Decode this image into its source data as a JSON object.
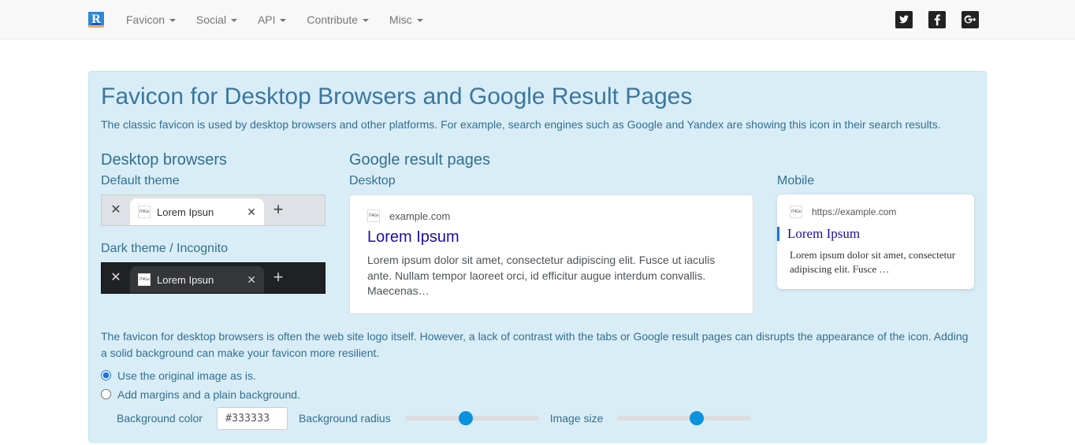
{
  "nav": {
    "brand": "R",
    "items": [
      "Favicon",
      "Social",
      "API",
      "Contribute",
      "Misc"
    ]
  },
  "panel": {
    "title": "Favicon for Desktop Browsers and Google Result Pages",
    "intro": "The classic favicon is used by desktop browsers and other platforms. For example, search engines such as Google and Yandex are showing this icon in their search results.",
    "desktop_browsers_heading": "Desktop browsers",
    "default_theme": "Default theme",
    "dark_theme": "Dark theme / Incognito",
    "google_heading": "Google result pages",
    "desktop_sub": "Desktop",
    "mobile_sub": "Mobile",
    "note": "The favicon for desktop browsers is often the web site logo itself. However, a lack of contrast with the tabs or Google result pages can disrupts the appearance of the icon. Adding a solid background can make your favicon more resilient."
  },
  "tab": {
    "favicon_text": "IT4Go",
    "title": "Lorem Ipsun"
  },
  "serp": {
    "favicon_text": "IT4Go",
    "url": "example.com",
    "title": "Lorem Ipsum",
    "desc": "Lorem ipsum dolor sit amet, consectetur adipiscing elit. Fusce ut iaculis ante. Nullam tempor laoreet orci, id efficitur augue interdum convallis. Maecenas…"
  },
  "mobile": {
    "favicon_text": "IT4Go",
    "url": "https://example.com",
    "title": "Lorem Ipsum",
    "desc": "Lorem ipsum dolor sit amet, consectetur adipiscing elit. Fusce …"
  },
  "options": {
    "opt1": "Use the original image as is.",
    "opt2": "Add margins and a plain background.",
    "bg_color_label": "Background color",
    "bg_color_value": "#333333",
    "bg_radius_label": "Background radius",
    "bg_radius_value": 45,
    "img_size_label": "Image size",
    "img_size_value": 60
  }
}
